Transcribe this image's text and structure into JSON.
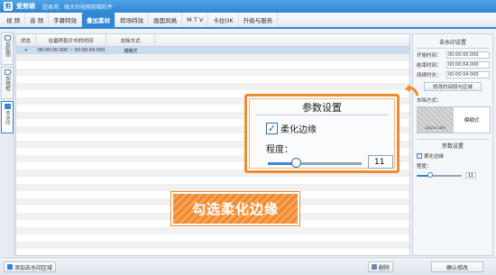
{
  "app": {
    "logo_char": "剪",
    "title": "爱剪辑",
    "subtitle": "超易用、强大的视频剪辑软件"
  },
  "menu": {
    "tabs": [
      {
        "label": "视 频"
      },
      {
        "label": "音 频"
      },
      {
        "label": "字幕特效"
      },
      {
        "label": "叠加素材",
        "active": true
      },
      {
        "label": "转场特效"
      },
      {
        "label": "画面风格"
      },
      {
        "label": "M T V"
      },
      {
        "label": "卡拉OK"
      },
      {
        "label": "升级与服务"
      }
    ]
  },
  "sidebar": {
    "items": [
      {
        "label": "加贴图",
        "icon": "sticker-icon"
      },
      {
        "label": "加相框",
        "icon": "frame-icon"
      },
      {
        "label": "去水印",
        "icon": "watermark-icon",
        "active": true
      }
    ]
  },
  "table": {
    "headers": [
      "状态",
      "在最终影片中的时间",
      "去除方式"
    ],
    "rows": [
      {
        "status": "★",
        "time": "00:00:00.000 ~ 00:00:04.000",
        "method": "模糊式"
      }
    ]
  },
  "right_panel": {
    "title": "去水印设置",
    "start_label": "开始时间：",
    "start_value": "00:00:00.000",
    "end_label": "结束时间：",
    "end_value": "00:00:04.000",
    "duration_label": "持续时长：",
    "duration_value": "00:00:04.000",
    "modify_button": "修改时间段与区域",
    "method_label": "去除方式：",
    "preview_caption": "Lbizus.com",
    "method_value": "模糊式",
    "params_title": "参数设置",
    "soften_label": "柔化边缘",
    "soften_checked": true,
    "degree_label": "程度：",
    "degree_value": "11",
    "degree_fraction": 0.3
  },
  "bottom": {
    "add_button": "添加去水印区域",
    "delete_button": "删除",
    "confirm_button": "确认修改"
  },
  "callout": {
    "title": "参数设置",
    "soften_label": "柔化边缘",
    "degree_label": "程度：",
    "degree_value": "11"
  },
  "caption": "勾选柔化边缘",
  "colors": {
    "accent": "#2f86d3",
    "highlight": "#f08a2d"
  }
}
